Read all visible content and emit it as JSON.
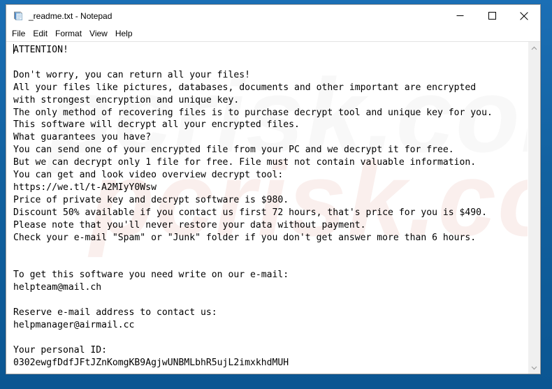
{
  "window": {
    "title": "_readme.txt - Notepad",
    "icon": "notepad-icon",
    "controls": {
      "minimize": "minimize-icon",
      "maximize": "maximize-icon",
      "close": "close-icon"
    }
  },
  "menu": {
    "items": [
      {
        "label": "File"
      },
      {
        "label": "Edit"
      },
      {
        "label": "Format"
      },
      {
        "label": "View"
      },
      {
        "label": "Help"
      }
    ]
  },
  "editor": {
    "watermark": "pcrisk.com",
    "text": "ATTENTION!\n\nDon't worry, you can return all your files!\nAll your files like pictures, databases, documents and other important are encrypted\nwith strongest encryption and unique key.\nThe only method of recovering files is to purchase decrypt tool and unique key for you.\nThis software will decrypt all your encrypted files.\nWhat guarantees you have?\nYou can send one of your encrypted file from your PC and we decrypt it for free.\nBut we can decrypt only 1 file for free. File must not contain valuable information.\nYou can get and look video overview decrypt tool:\nhttps://we.tl/t-A2MIyY0Wsw\nPrice of private key and decrypt software is $980.\nDiscount 50% available if you contact us first 72 hours, that's price for you is $490.\nPlease note that you'll never restore your data without payment.\nCheck your e-mail \"Spam\" or \"Junk\" folder if you don't get answer more than 6 hours.\n\n\nTo get this software you need write on our e-mail:\nhelpteam@mail.ch\n\nReserve e-mail address to contact us:\nhelpmanager@airmail.cc\n\nYour personal ID:\n0302ewgfDdfJFtJZnKomgKB9AgjwUNBMLbhR5ujL2imxkhdMUH",
    "details": {
      "video_url": "https://we.tl/t-A2MIyY0Wsw",
      "price_full": "$980",
      "price_discount": "$490",
      "discount_percent": "50%",
      "discount_window": "72 hours",
      "response_time": "6 hours",
      "email_primary": "helpteam@mail.ch",
      "email_reserve": "helpmanager@airmail.cc",
      "personal_id": "0302ewgfDdfJFtJZnKomgKB9AgjwUNBMLbhR5ujL2imxkhdMUH"
    }
  },
  "scrollbar": {
    "up_arrow": "chevron-up-icon",
    "down_arrow": "chevron-down-icon"
  },
  "colors": {
    "desktop": "#12619f",
    "window_bg": "#ffffff",
    "text": "#000000",
    "scrollbar_track": "#f0f0f0"
  }
}
